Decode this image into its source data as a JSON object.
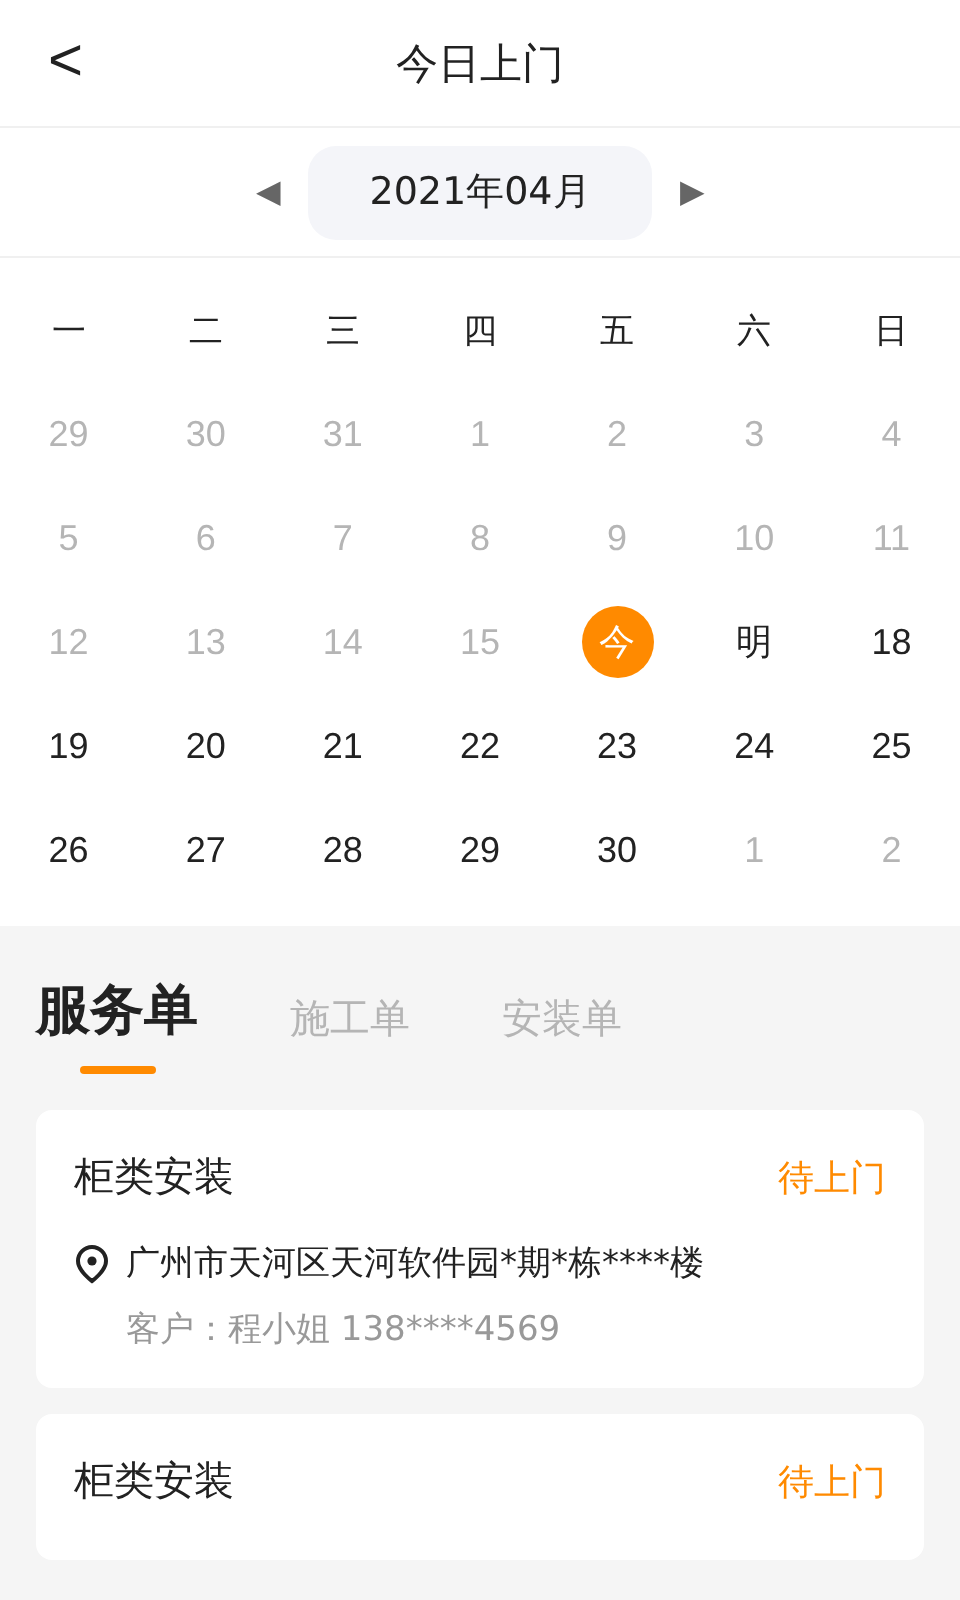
{
  "header": {
    "back": "<",
    "title": "今日上门"
  },
  "month_bar": {
    "prev": "◀",
    "label": "2021年04月",
    "next": "▶"
  },
  "weekdays": [
    "一",
    "二",
    "三",
    "四",
    "五",
    "六",
    "日"
  ],
  "days": [
    {
      "label": "29",
      "muted": true,
      "selected": false
    },
    {
      "label": "30",
      "muted": true,
      "selected": false
    },
    {
      "label": "31",
      "muted": true,
      "selected": false
    },
    {
      "label": "1",
      "muted": true,
      "selected": false
    },
    {
      "label": "2",
      "muted": true,
      "selected": false
    },
    {
      "label": "3",
      "muted": true,
      "selected": false
    },
    {
      "label": "4",
      "muted": true,
      "selected": false
    },
    {
      "label": "5",
      "muted": true,
      "selected": false
    },
    {
      "label": "6",
      "muted": true,
      "selected": false
    },
    {
      "label": "7",
      "muted": true,
      "selected": false
    },
    {
      "label": "8",
      "muted": true,
      "selected": false
    },
    {
      "label": "9",
      "muted": true,
      "selected": false
    },
    {
      "label": "10",
      "muted": true,
      "selected": false
    },
    {
      "label": "11",
      "muted": true,
      "selected": false
    },
    {
      "label": "12",
      "muted": true,
      "selected": false
    },
    {
      "label": "13",
      "muted": true,
      "selected": false
    },
    {
      "label": "14",
      "muted": true,
      "selected": false
    },
    {
      "label": "15",
      "muted": true,
      "selected": false
    },
    {
      "label": "今",
      "muted": false,
      "selected": true
    },
    {
      "label": "明",
      "muted": false,
      "selected": false
    },
    {
      "label": "18",
      "muted": false,
      "selected": false
    },
    {
      "label": "19",
      "muted": false,
      "selected": false
    },
    {
      "label": "20",
      "muted": false,
      "selected": false
    },
    {
      "label": "21",
      "muted": false,
      "selected": false
    },
    {
      "label": "22",
      "muted": false,
      "selected": false
    },
    {
      "label": "23",
      "muted": false,
      "selected": false
    },
    {
      "label": "24",
      "muted": false,
      "selected": false
    },
    {
      "label": "25",
      "muted": false,
      "selected": false
    },
    {
      "label": "26",
      "muted": false,
      "selected": false
    },
    {
      "label": "27",
      "muted": false,
      "selected": false
    },
    {
      "label": "28",
      "muted": false,
      "selected": false
    },
    {
      "label": "29",
      "muted": false,
      "selected": false
    },
    {
      "label": "30",
      "muted": false,
      "selected": false
    },
    {
      "label": "1",
      "muted": true,
      "selected": false
    },
    {
      "label": "2",
      "muted": true,
      "selected": false
    }
  ],
  "tabs": [
    {
      "label": "服务单",
      "selected": true
    },
    {
      "label": "施工单",
      "selected": false
    },
    {
      "label": "安装单",
      "selected": false
    }
  ],
  "orders": [
    {
      "title": "柜类安装",
      "status": "待上门",
      "address": "广州市天河区天河软件园*期*栋****楼",
      "customer": "客户：程小姐 138****4569"
    },
    {
      "title": "柜类安装",
      "status": "待上门"
    }
  ]
}
